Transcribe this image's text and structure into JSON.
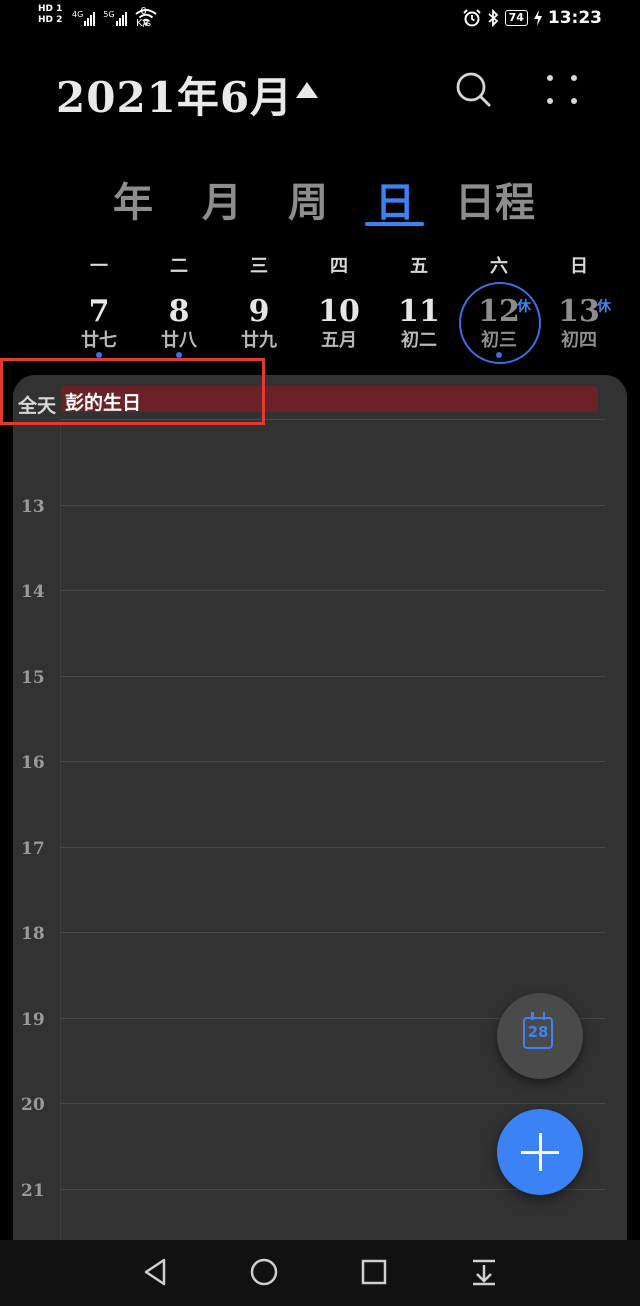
{
  "status_bar": {
    "hd1": "HD 1",
    "hd2": "HD 2",
    "net1": "4G",
    "net2": "5G",
    "speed_value": "0",
    "speed_unit": "K/s",
    "battery": "74",
    "time": "13:23"
  },
  "header": {
    "title": "2021年6月"
  },
  "view_tabs": [
    {
      "label": "年"
    },
    {
      "label": "月"
    },
    {
      "label": "周"
    },
    {
      "label": "日"
    },
    {
      "label": "日程"
    }
  ],
  "week": {
    "days": [
      {
        "dow": "一",
        "num": "7",
        "lunar": "廿七"
      },
      {
        "dow": "二",
        "num": "8",
        "lunar": "廿八"
      },
      {
        "dow": "三",
        "num": "9",
        "lunar": "廿九"
      },
      {
        "dow": "四",
        "num": "10",
        "lunar": "五月"
      },
      {
        "dow": "五",
        "num": "11",
        "lunar": "初二"
      },
      {
        "dow": "六",
        "num": "12",
        "lunar": "初三",
        "badge": "休"
      },
      {
        "dow": "日",
        "num": "13",
        "lunar": "初四",
        "badge": "休"
      }
    ]
  },
  "day_view": {
    "allday_label": "全天",
    "allday_event": "彭的生日",
    "hours": [
      "13",
      "14",
      "15",
      "16",
      "17",
      "18",
      "19",
      "20",
      "21"
    ]
  },
  "fab": {
    "today_date": "28"
  },
  "colors": {
    "accent": "#3d83f5",
    "event_bg": "#6a2226",
    "highlight": "#e3392f"
  }
}
